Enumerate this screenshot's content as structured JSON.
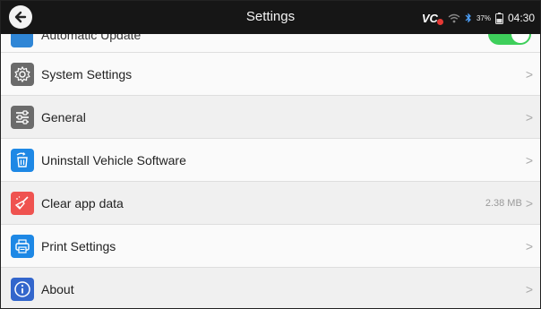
{
  "header": {
    "title": "Settings",
    "vci_label": "VC",
    "battery": "37%",
    "time": "04:30"
  },
  "partial_row": {
    "label": "Automatic Update"
  },
  "rows": [
    {
      "label": "System Settings",
      "value": ""
    },
    {
      "label": "General",
      "value": ""
    },
    {
      "label": "Uninstall Vehicle Software",
      "value": ""
    },
    {
      "label": "Clear app data",
      "value": "2.38 MB"
    },
    {
      "label": "Print Settings",
      "value": ""
    },
    {
      "label": "About",
      "value": ""
    }
  ],
  "icons": {
    "system_settings": "gear-icon",
    "general": "sliders-icon",
    "uninstall": "trash-icon",
    "clear_data": "broom-icon",
    "print": "printer-icon",
    "about": "info-icon"
  },
  "colors": {
    "topbar": "#161616",
    "toggle_on": "#3ecf5b",
    "gray_icon": "#6b6b6b",
    "blue_icon": "#1e88e5",
    "red_icon": "#ef5350",
    "about_icon": "#3366cc"
  },
  "chevron": ">"
}
